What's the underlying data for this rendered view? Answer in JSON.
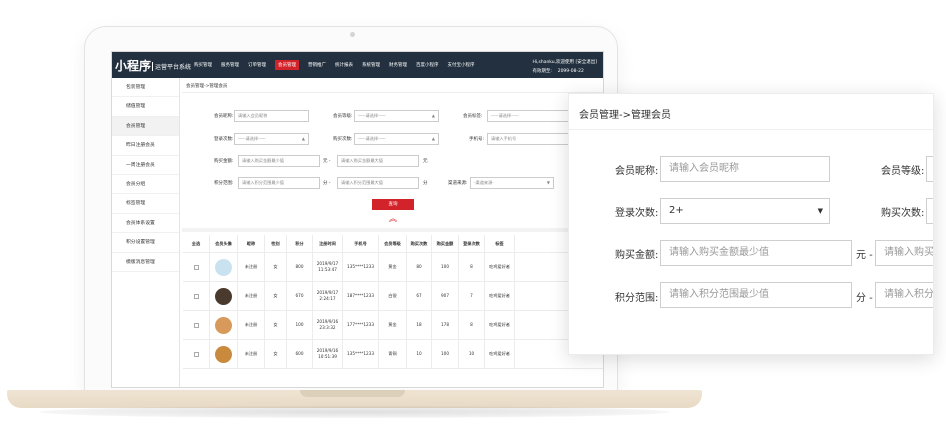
{
  "app": {
    "logo": "小程序",
    "logo_sub": "运营平台系统",
    "nav": [
      "购买管理",
      "服务管理",
      "订单管理",
      "会员管理",
      "营销推广",
      "统计报表",
      "系统管理",
      "财务管理",
      "百度小程序",
      "支付宝小程序"
    ],
    "nav_active_index": 3,
    "user_line": "Hi,shanku,欢迎使用 [安全退出]",
    "expiry_label": "有效期至:",
    "expiry_date": "2099-08-22"
  },
  "sidebar": {
    "items": [
      "包装管理",
      "储值管理",
      "会员管理",
      "昨日注册会员",
      "一周注册会员",
      "会员分组",
      "标签管理",
      "会员体系设置",
      "积分设置管理",
      "模版消息管理"
    ],
    "active_index": 2
  },
  "breadcrumb": "会员管理->管理会员",
  "filters": {
    "nickname_label": "会员昵称:",
    "nickname_placeholder": "请输入会员昵称",
    "level_label": "会员等级:",
    "level_value": "-----请选择-----",
    "tag_label": "会员标签:",
    "tag_value": "-----请选择-----",
    "login_label": "登录次数:",
    "login_value": "-----请选择-----",
    "buy_times_label": "购买次数:",
    "buy_times_value": "-----请选择-----",
    "phone_label": "手机号:",
    "phone_placeholder": "请输入手机号",
    "buy_amount_label": "购买金额:",
    "buy_amount_min": "请输入购买金额最少值",
    "buy_amount_sep": "元 -",
    "buy_amount_max": "请输入购买金额最大值",
    "buy_amount_unit": "元",
    "points_label": "积分范围:",
    "points_min": "请输入积分范围最少值",
    "points_sep": "分 -",
    "points_max": "请输入积分范围最大值",
    "points_unit": "分",
    "source_label": "渠道来源:",
    "source_value": "-渠道来源-",
    "query_button": "查询",
    "collapse_icon": "double-chevron-up-icon"
  },
  "table": {
    "headers": [
      "全选",
      "会员头像",
      "昵称",
      "性别",
      "积分",
      "注册时间",
      "手机号",
      "会员等级",
      "购买次数",
      "购买金额",
      "登录次数",
      "标签"
    ],
    "rows": [
      {
        "nickname": "未注册",
        "gender": "女",
        "points": "800",
        "time": "2019/9/17 11:53:47",
        "phone": "135****1233",
        "level": "黄金",
        "buy_times": "80",
        "amount": "100",
        "logins": "8",
        "tag": "吃鸡爱好者",
        "avatar_color": "#c8e3ef"
      },
      {
        "nickname": "未注册",
        "gender": "女",
        "points": "670",
        "time": "2019/9/17 2:24:17",
        "phone": "187****1233",
        "level": "白银",
        "buy_times": "67",
        "amount": "907",
        "logins": "7",
        "tag": "吃鸡爱好者",
        "avatar_color": "#4a3a2e"
      },
      {
        "nickname": "未注册",
        "gender": "女",
        "points": "100",
        "time": "2019/9/16 23:3:32",
        "phone": "177****1233",
        "level": "黄金",
        "buy_times": "18",
        "amount": "178",
        "logins": "8",
        "tag": "吃鸡爱好者",
        "avatar_color": "#d79a5a"
      },
      {
        "nickname": "未注册",
        "gender": "女",
        "points": "600",
        "time": "2019/9/16 10:51:39",
        "phone": "135****1233",
        "level": "青铜",
        "buy_times": "10",
        "amount": "100",
        "logins": "10",
        "tag": "吃鸡爱好者",
        "avatar_color": "#c98a3e"
      }
    ]
  },
  "popup": {
    "title": "会员管理->管理会员",
    "nickname_label": "会员昵称:",
    "nickname_placeholder": "请输入会员昵称",
    "level_label": "会员等级:",
    "login_label": "登录次数:",
    "login_value": "2+",
    "buy_times_label": "购买次数:",
    "buy_amount_label": "购买金额:",
    "buy_amount_min": "请输入购买金额最少值",
    "buy_amount_sep": "元 -",
    "buy_amount_max": "请输入购买金额最大值",
    "points_label": "积分范围:",
    "points_min": "请输入积分范围最少值",
    "points_sep": "分 -",
    "points_max": "请输入积分范围最大值"
  },
  "colors": {
    "topbar": "#22303f",
    "accent": "#d2232a",
    "laptop_base": "#efe4d3"
  }
}
